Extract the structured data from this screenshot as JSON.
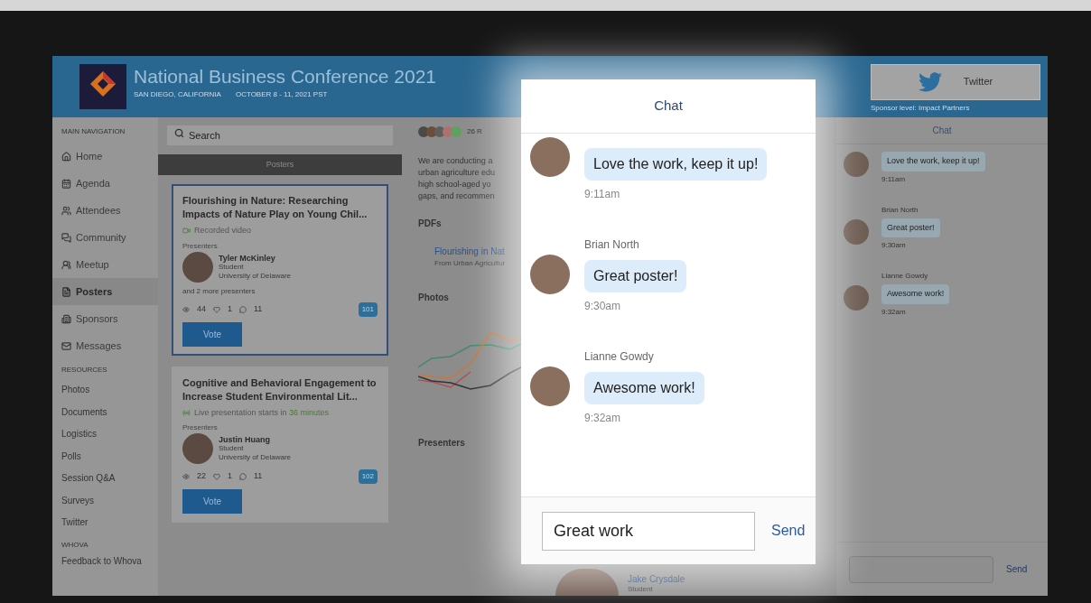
{
  "header": {
    "title": "National Business Conference 2021",
    "location": "SAN DIEGO, CALIFORNIA",
    "dates": "OCTOBER 8 - 11, 2021 PST",
    "sponsor_button": "Twitter",
    "sponsor_level": "Sponsor level: Impact Partners"
  },
  "sidebar": {
    "main_heading": "MAIN NAVIGATION",
    "main_items": [
      {
        "label": "Home",
        "kind": "home",
        "selected": false
      },
      {
        "label": "Agenda",
        "kind": "agenda",
        "selected": false
      },
      {
        "label": "Attendees",
        "kind": "attendees",
        "selected": false
      },
      {
        "label": "Community",
        "kind": "community",
        "selected": false
      },
      {
        "label": "Meetup",
        "kind": "meetup",
        "selected": false
      },
      {
        "label": "Posters",
        "kind": "posters",
        "selected": true
      },
      {
        "label": "Sponsors",
        "kind": "sponsors",
        "selected": false
      },
      {
        "label": "Messages",
        "kind": "messages",
        "selected": false
      }
    ],
    "resources_heading": "RESOURCES",
    "resources": [
      "Photos",
      "Documents",
      "Logistics",
      "Polls",
      "Session Q&A",
      "Surveys",
      "Twitter"
    ],
    "whova_heading": "WHOVA",
    "whova": [
      "Feedback to Whova"
    ]
  },
  "search": {
    "placeholder": "Search"
  },
  "posters": {
    "heading": "Posters",
    "cards": [
      {
        "title": "Flourishing in Nature: Researching Impacts of Nature Play on Young Chil...",
        "selected": true,
        "kind": "recorded",
        "status_text": "Recorded video",
        "presenters_label": "Presenters",
        "presenter": {
          "name": "Tyler McKinley",
          "role": "Student",
          "org": "University of Delaware"
        },
        "more": "and 2 more presenters",
        "views": "44",
        "likes": "1",
        "comments": "11",
        "votes": "101",
        "vote_button": "Vote"
      },
      {
        "title": "Cognitive and Behavioral Engagement to Increase Student Environmental Lit...",
        "selected": false,
        "kind": "live",
        "status_text": "Live presentation starts in",
        "status_highlight": "36 minutes",
        "presenters_label": "Presenters",
        "presenter": {
          "name": "Justin Huang",
          "role": "Student",
          "org": "University of Delaware"
        },
        "views": "22",
        "likes": "1",
        "comments": "11",
        "votes": "102",
        "vote_button": "Vote"
      }
    ]
  },
  "detail": {
    "attendee_count": "26 R",
    "description": [
      "We are conducting a",
      "urban agriculture edu",
      "high school-aged yo",
      "gaps, and recommen"
    ],
    "pdfs_heading": "PDFs",
    "pdf_title": "Flourishing in Nat",
    "pdf_source": "From Urban Agricultur",
    "photos_heading": "Photos",
    "presenters_heading": "Presenters",
    "presenter_name": "Jake Crysdale",
    "presenter_role": "Student"
  },
  "chat_popup": {
    "title": "Chat",
    "messages": [
      {
        "text": "Love the work, keep it up!",
        "time": "9:11am"
      },
      {
        "author": "Brian North",
        "text": "Great poster!",
        "time": "9:30am"
      },
      {
        "author": "Lianne Gowdy",
        "text": "Awesome work!",
        "time": "9:32am"
      }
    ],
    "input_value": "Great work",
    "send": "Send"
  },
  "chat_panel": {
    "title": "Chat",
    "messages": [
      {
        "text": "Love the work, keep it up!",
        "time": "9:11am"
      },
      {
        "author": "Brian North",
        "text": "Great poster!",
        "time": "9:30am"
      },
      {
        "author": "Lianne Gowdy",
        "text": "Awesome work!",
        "time": "9:32am"
      }
    ],
    "send": "Send"
  }
}
